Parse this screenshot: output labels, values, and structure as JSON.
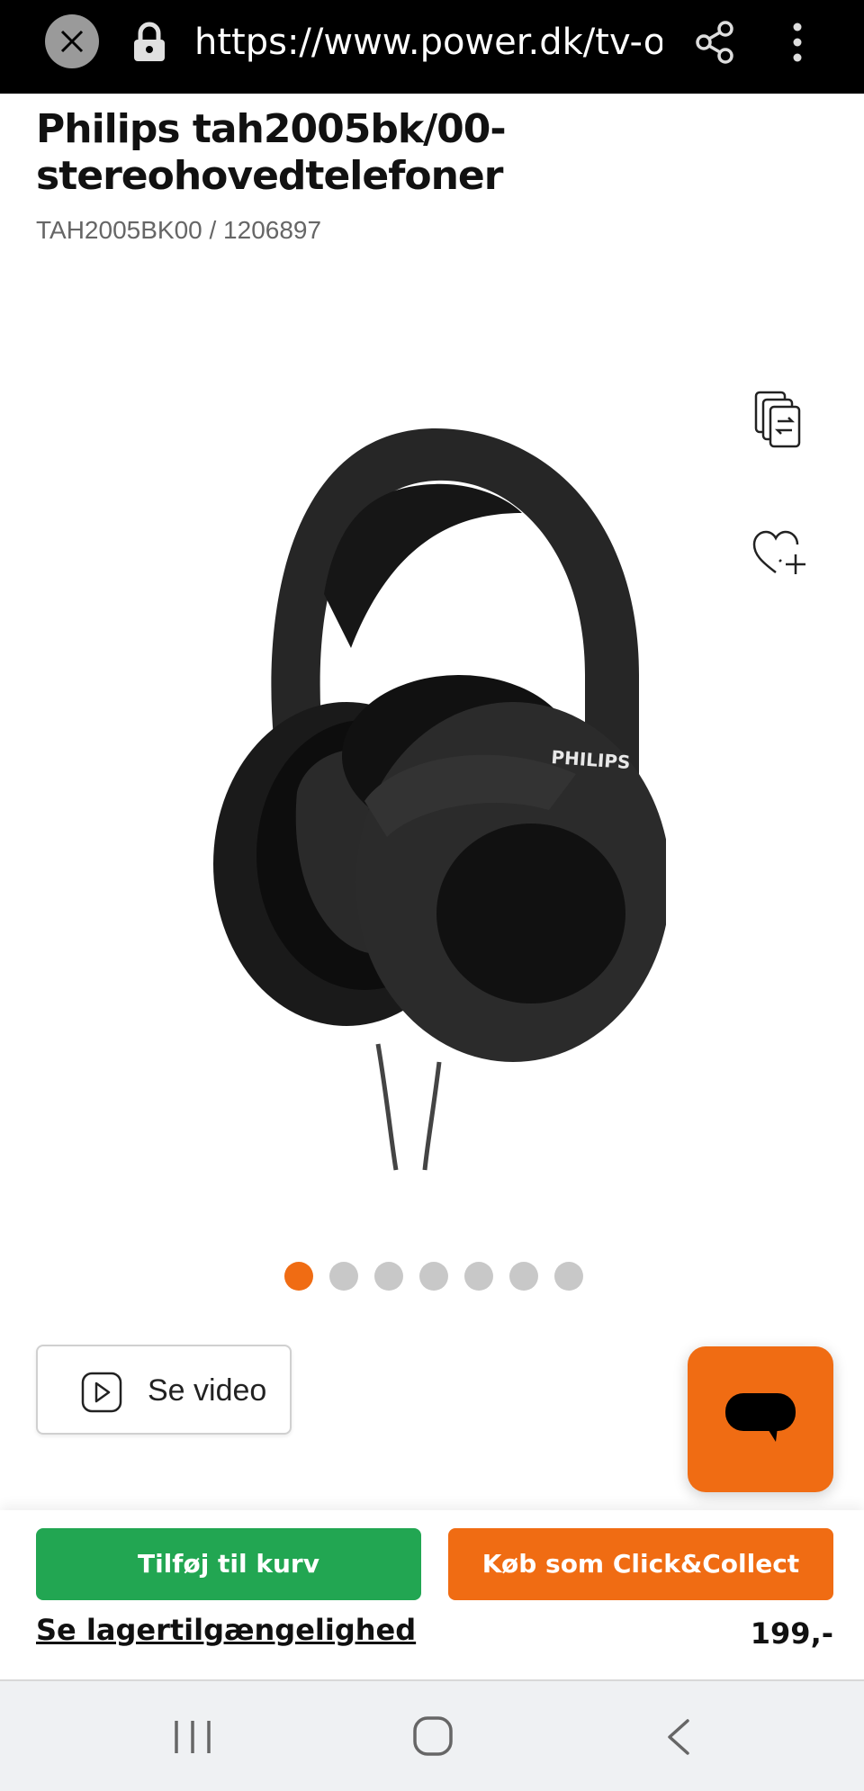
{
  "browser": {
    "url": "https://www.power.dk/tv-og-",
    "icons": [
      "close-icon",
      "lock-icon",
      "share-icon",
      "more-vertical-icon"
    ]
  },
  "product": {
    "title": "Philips tah2005bk/00-stereohovedtelefoner",
    "sku": "TAH2005BK00 / 1206897",
    "brand_on_image": "PHILIPS",
    "image_icon": "headphones-product-image"
  },
  "carousel": {
    "total": 7,
    "active_index": 0
  },
  "video_button": {
    "label": "Se video",
    "icon": "play-icon"
  },
  "actions": {
    "add_to_cart": "Tilføj til kurv",
    "click_collect": "Køb som Click&Collect",
    "stock_link": "Se lagertilgængelighed",
    "price": "199,-"
  },
  "colors": {
    "accent_orange": "#f06c13",
    "cart_green": "#22a652",
    "browser_bar": "#000000"
  },
  "nav": {
    "icons": [
      "recents-icon",
      "home-icon",
      "back-icon"
    ]
  }
}
